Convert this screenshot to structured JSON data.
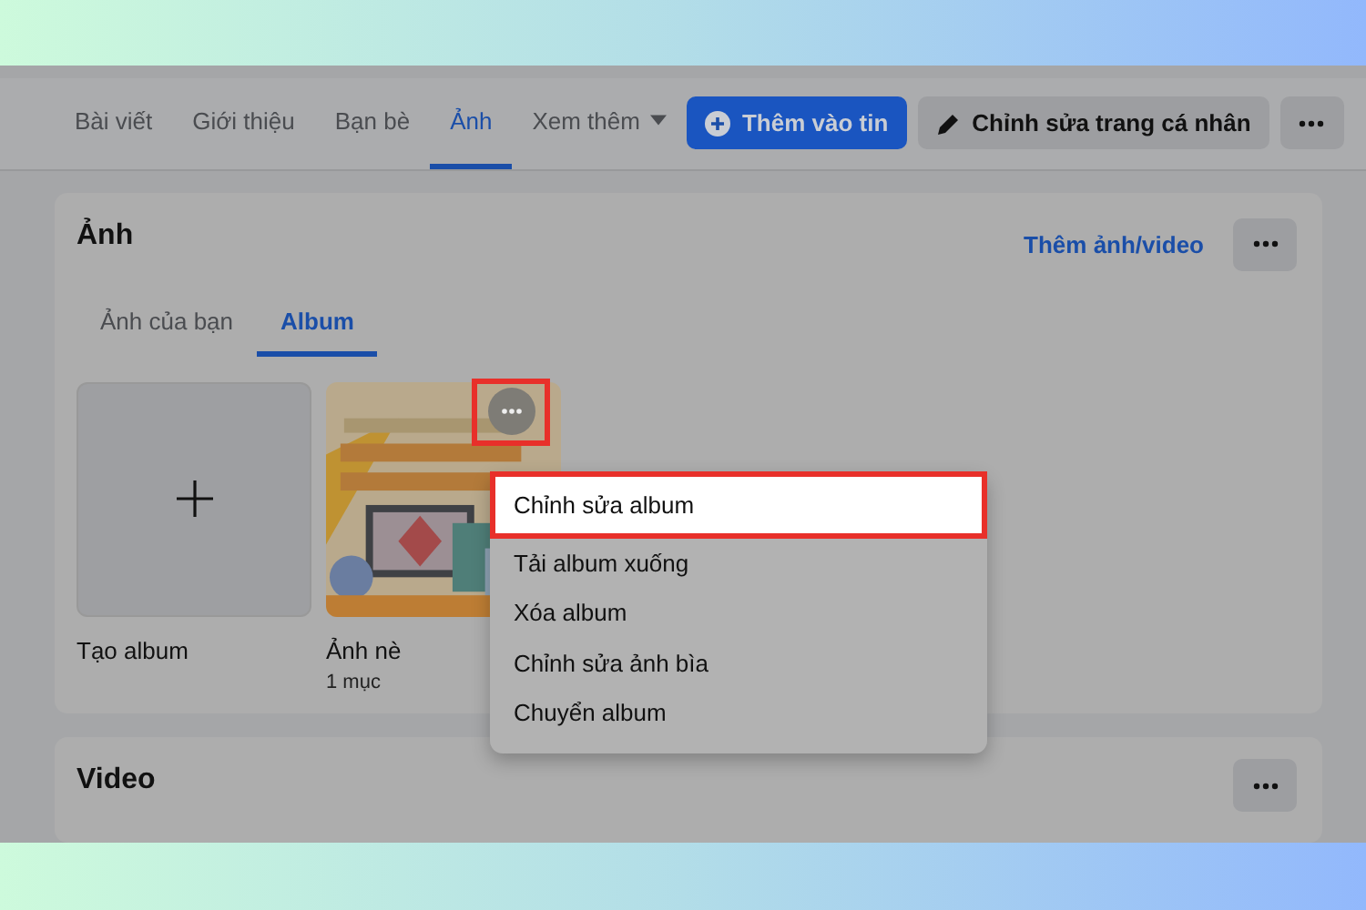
{
  "profile_tabs": [
    {
      "label": "Bài viết",
      "selected": false,
      "dropdown": false
    },
    {
      "label": "Giới thiệu",
      "selected": false,
      "dropdown": false
    },
    {
      "label": "Bạn bè",
      "selected": false,
      "dropdown": false
    },
    {
      "label": "Ảnh",
      "selected": true,
      "dropdown": false
    },
    {
      "label": "Xem thêm",
      "selected": false,
      "dropdown": true
    }
  ],
  "profile_buttons": [
    {
      "kind": "add-story",
      "label": "Thêm vào tin"
    },
    {
      "kind": "edit-profile",
      "label": "Chỉnh sửa trang cá nhân"
    },
    {
      "kind": "more"
    }
  ],
  "photos": {
    "title": "Ảnh",
    "action_link": "Thêm ảnh/video",
    "tabs": [
      {
        "label": "Ảnh của bạn",
        "selected": false
      },
      {
        "label": "Album",
        "selected": true
      }
    ],
    "albums": [
      {
        "kind": "create",
        "name": "Tạo album"
      },
      {
        "kind": "album",
        "name": "Ảnh nè",
        "count": "1 mục",
        "menu_highlighted": true
      }
    ]
  },
  "album_menu": [
    {
      "label": "Chỉnh sửa album",
      "highlighted": true
    },
    {
      "label": "Tải album xuống",
      "highlighted": false
    },
    {
      "label": "Xóa album",
      "highlighted": false
    },
    {
      "label": "Chỉnh sửa ảnh bìa",
      "highlighted": false
    },
    {
      "label": "Chuyển album",
      "highlighted": false
    }
  ],
  "video": {
    "title": "Video"
  }
}
